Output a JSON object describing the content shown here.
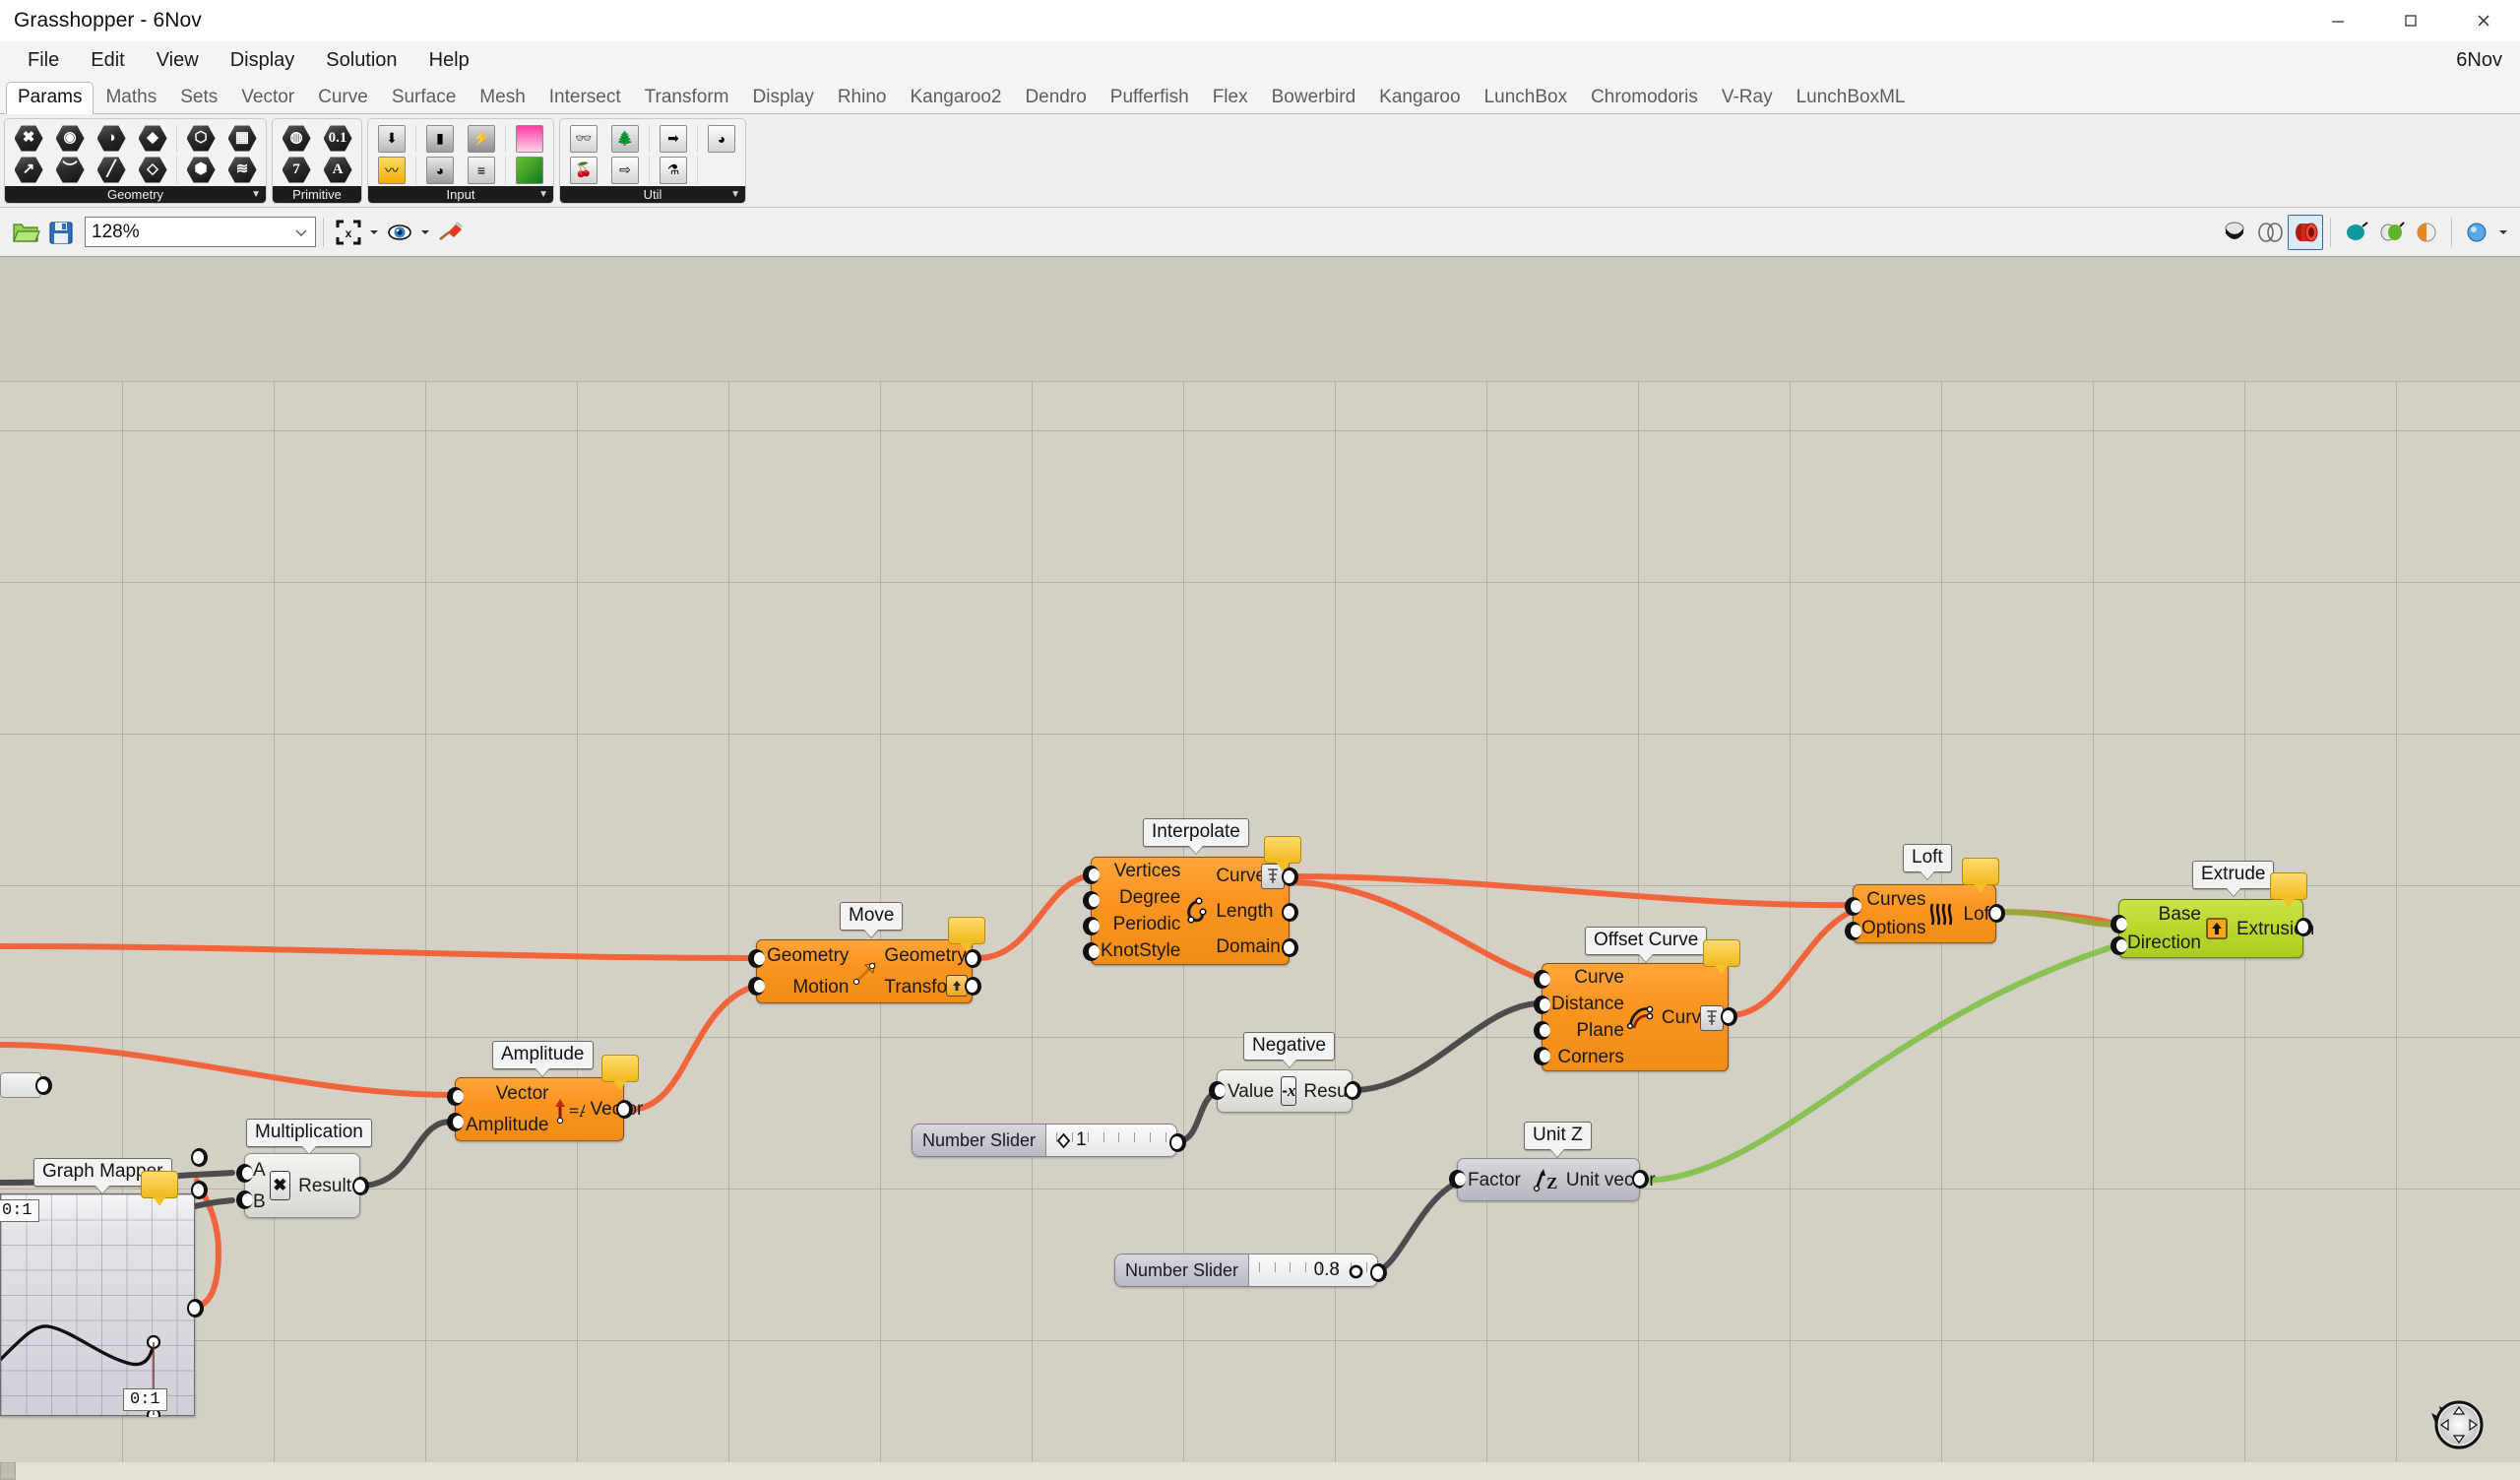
{
  "window": {
    "title": "Grasshopper - 6Nov",
    "controls": [
      "minimize",
      "maximize",
      "close"
    ]
  },
  "menubar": {
    "items": [
      "File",
      "Edit",
      "View",
      "Display",
      "Solution",
      "Help"
    ],
    "right_label": "6Nov"
  },
  "tabs": [
    {
      "label": "Params",
      "active": true
    },
    {
      "label": "Maths",
      "active": false
    },
    {
      "label": "Sets",
      "active": false
    },
    {
      "label": "Vector",
      "active": false
    },
    {
      "label": "Curve",
      "active": false
    },
    {
      "label": "Surface",
      "active": false
    },
    {
      "label": "Mesh",
      "active": false
    },
    {
      "label": "Intersect",
      "active": false
    },
    {
      "label": "Transform",
      "active": false
    },
    {
      "label": "Display",
      "active": false
    },
    {
      "label": "Rhino",
      "active": false
    },
    {
      "label": "Kangaroo2",
      "active": false
    },
    {
      "label": "Dendro",
      "active": false
    },
    {
      "label": "Pufferfish",
      "active": false
    },
    {
      "label": "Flex",
      "active": false
    },
    {
      "label": "Bowerbird",
      "active": false
    },
    {
      "label": "Kangaroo",
      "active": false
    },
    {
      "label": "LunchBox",
      "active": false
    },
    {
      "label": "Chromodoris",
      "active": false
    },
    {
      "label": "V-Ray",
      "active": false
    },
    {
      "label": "LunchBoxML",
      "active": false
    }
  ],
  "ribbon": {
    "groups": [
      {
        "caption": "Geometry",
        "has_dropdown": true,
        "rows": [
          [
            "geometry-param-icon",
            "circular-param-icon",
            "brep-param-icon",
            "surface-param-icon",
            "box-param-icon",
            "mesh-param-icon"
          ],
          [
            "vector-param-icon",
            "curve-param-icon",
            "line-param-icon",
            "plane-param-icon",
            "subd-param-icon",
            "field-param-icon"
          ]
        ]
      },
      {
        "caption": "Primitive",
        "has_dropdown": false,
        "rows": [
          [
            "boolean-param-icon",
            "number-param-icon"
          ],
          [
            "integer-param-icon",
            "text-param-icon"
          ]
        ]
      },
      {
        "caption": "Input",
        "has_dropdown": true,
        "rows": [
          [
            "number-slider-icon",
            "boolean-toggle-icon",
            "button-icon",
            "gradient-icon"
          ],
          [
            "graph-mapper-icon",
            "knob-icon",
            "value-list-icon",
            "colour-swatch-icon"
          ]
        ]
      },
      {
        "caption": "Util",
        "has_dropdown": true,
        "rows": [
          [
            "group-icon",
            "data-tree-icon",
            "relay-icon",
            "jitter-icon"
          ],
          [
            "cherry-picker-icon",
            "relay-outline-icon",
            "flask-icon"
          ]
        ]
      }
    ]
  },
  "toolbar": {
    "open_icon": "open-folder-icon",
    "save_icon": "save-disk-icon",
    "zoom_value": "128%",
    "zoom_dropdown_icon": "chevron-down-icon",
    "zoom_extents_icon": "zoom-extents-icon",
    "preview_eye_icon": "preview-eye-icon",
    "bake_icon": "bake-paintbrush-icon",
    "right_icons": [
      "shaded-preview-icon",
      "wireframe-preview-icon",
      "preview-off-icon",
      "transparent-preview-icon",
      "meshed-preview-icon",
      "shade-half-icon",
      "sphere-display-icon"
    ]
  },
  "canvas": {
    "nodes": [
      {
        "id": "graph-mapper",
        "name": "Graph Mapper",
        "kind": "graph-mapper",
        "axis_label_top": "0:1",
        "axis_label_bottom": "0:1"
      },
      {
        "id": "multiplication",
        "name": "Multiplication",
        "kind": "flat",
        "icon": "multiply-icon",
        "inputs": [
          "A",
          "B"
        ],
        "outputs": [
          "Result"
        ]
      },
      {
        "id": "amplitude",
        "name": "Amplitude",
        "kind": "orange",
        "icon": "amplitude-icon",
        "inputs": [
          "Vector",
          "Amplitude"
        ],
        "outputs": [
          "Vector"
        ],
        "warning": true
      },
      {
        "id": "move",
        "name": "Move",
        "kind": "orange",
        "icon": "move-arrow-icon",
        "inputs": [
          "Geometry",
          "Motion"
        ],
        "outputs": [
          "Geometry",
          "Transform"
        ],
        "warning": true,
        "badge": "transform-up-icon"
      },
      {
        "id": "interpolate",
        "name": "Interpolate",
        "kind": "orange",
        "icon": "interpolate-curve-icon",
        "inputs": [
          "Vertices",
          "Degree",
          "Periodic",
          "KnotStyle"
        ],
        "outputs": [
          "Curve",
          "Length",
          "Domain"
        ],
        "warning": true,
        "badge": "flatten-icon"
      },
      {
        "id": "negative",
        "name": "Negative",
        "kind": "flat",
        "icon": "negative-x-icon",
        "inputs": [
          "Value"
        ],
        "outputs": [
          "Result"
        ]
      },
      {
        "id": "offset-curve",
        "name": "Offset Curve",
        "kind": "orange",
        "icon": "offset-curve-icon",
        "inputs": [
          "Curve",
          "Distance",
          "Plane",
          "Corners"
        ],
        "outputs": [
          "Curve"
        ],
        "warning": true,
        "badge": "flatten-icon"
      },
      {
        "id": "unit-z",
        "name": "Unit Z",
        "kind": "flat-blue",
        "icon": "unit-z-icon",
        "inputs": [
          "Factor"
        ],
        "outputs": [
          "Unit vector"
        ]
      },
      {
        "id": "loft",
        "name": "Loft",
        "kind": "orange",
        "icon": "loft-icon",
        "inputs": [
          "Curves",
          "Options"
        ],
        "outputs": [
          "Loft"
        ],
        "warning": true
      },
      {
        "id": "extrude",
        "name": "Extrude",
        "kind": "green",
        "icon": "extrude-icon",
        "inputs": [
          "Base",
          "Direction"
        ],
        "outputs": [
          "Extrusion"
        ],
        "warning": true
      }
    ],
    "sliders": [
      {
        "id": "slider-top",
        "label": "Number Slider",
        "value": "1",
        "knob": "diamond",
        "knob_pos_pct": 7
      },
      {
        "id": "slider-bottom",
        "label": "Number Slider",
        "value": "0.8",
        "knob": "circle",
        "knob_pos_pct": 80
      }
    ],
    "compass_icon": "navigation-compass-icon"
  },
  "colors": {
    "component_orange": "#fb9421",
    "component_green": "#bcd92f",
    "component_grey": "#e4e4e0",
    "wire_orange": "#f0643c",
    "wire_grey": "#4c4c4c",
    "wire_green": "#7cc34a",
    "warning_yellow": "#f0b81d",
    "canvas_bg": "#d4d0c6",
    "accent_selected": "#2b6ca3"
  }
}
